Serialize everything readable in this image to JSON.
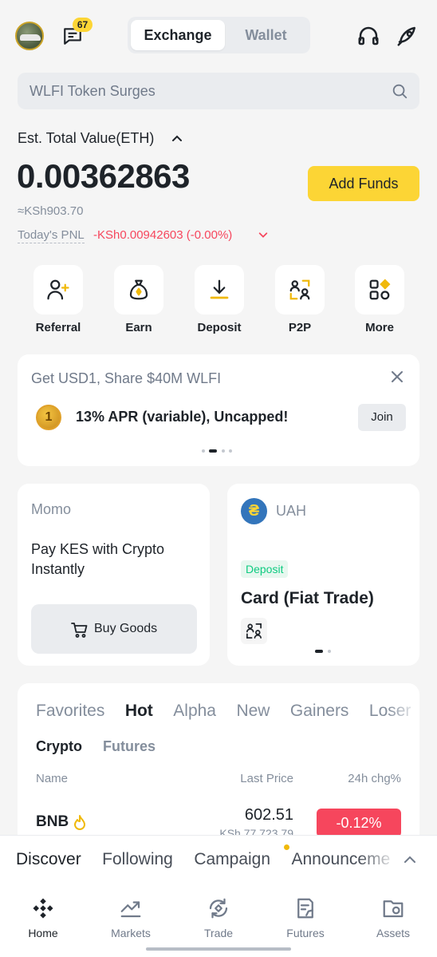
{
  "header": {
    "notification_count": "67",
    "segment": {
      "exchange": "Exchange",
      "wallet": "Wallet"
    }
  },
  "search": {
    "placeholder": "WLFI Token Surges"
  },
  "balance": {
    "label": "Est. Total Value(ETH)",
    "value": "0.00362863",
    "fiat": "≈KSh903.70",
    "pnl_label": "Today's PNL",
    "pnl_value": "-KSh0.00942603 (-0.00%)",
    "add_funds": "Add Funds"
  },
  "quick_actions": [
    {
      "label": "Referral",
      "icon": "referral-icon"
    },
    {
      "label": "Earn",
      "icon": "earn-icon"
    },
    {
      "label": "Deposit",
      "icon": "deposit-icon"
    },
    {
      "label": "P2P",
      "icon": "p2p-icon"
    },
    {
      "label": "More",
      "icon": "more-icon"
    }
  ],
  "promo": {
    "title": "Get USD1, Share $40M WLFI",
    "coin": "1",
    "text": "13% APR (variable), Uncapped!",
    "join": "Join"
  },
  "momo_card": {
    "title": "Momo",
    "description": "Pay KES with Crypto Instantly",
    "button": "Buy Goods"
  },
  "uah_card": {
    "currency_symbol": "₴",
    "title": "UAH",
    "tag": "Deposit",
    "heading": "Card (Fiat Trade)"
  },
  "market": {
    "tabs": [
      "Favorites",
      "Hot",
      "Alpha",
      "New",
      "Gainers",
      "Losers"
    ],
    "active_tab": "Hot",
    "subtabs": {
      "crypto": "Crypto",
      "futures": "Futures"
    },
    "columns": {
      "name": "Name",
      "last_price": "Last Price",
      "change": "24h chg%"
    },
    "rows": [
      {
        "name": "BNB",
        "price": "602.51",
        "fiat_price": "KSh 77,723.79",
        "change": "-0.12%"
      }
    ]
  },
  "discover": {
    "tabs": [
      "Discover",
      "Following",
      "Campaign",
      "Announcements"
    ]
  },
  "bottom_nav": [
    {
      "label": "Home",
      "icon": "home-icon"
    },
    {
      "label": "Markets",
      "icon": "markets-icon"
    },
    {
      "label": "Trade",
      "icon": "trade-icon"
    },
    {
      "label": "Futures",
      "icon": "futures-icon"
    },
    {
      "label": "Assets",
      "icon": "assets-icon"
    }
  ],
  "colors": {
    "brand": "#fcd535",
    "negative": "#f6465d",
    "positive": "#0ecb81",
    "text": "#1e2329",
    "muted": "#848e9c"
  }
}
